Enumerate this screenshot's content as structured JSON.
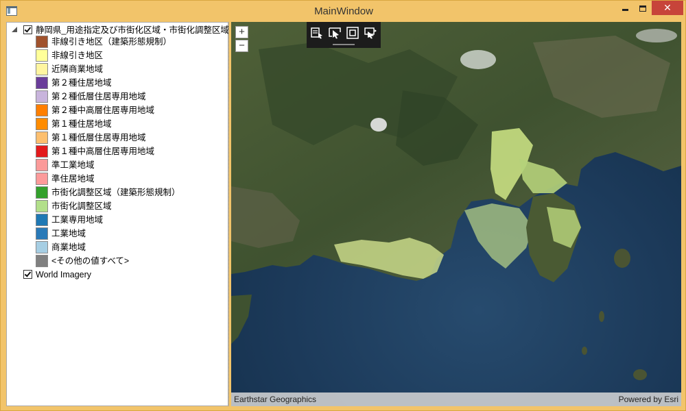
{
  "window": {
    "title": "MainWindow",
    "close_glyph": "✕"
  },
  "map_controls": {
    "zoom_in": "+",
    "zoom_out": "−"
  },
  "toolbar": {
    "tools": [
      "select-add-icon",
      "select-pointer-icon",
      "select-rectangle-icon",
      "select-move-icon"
    ]
  },
  "layers": [
    {
      "label": "静岡県_用途指定及び市街化区域・市街化調整区域",
      "checked": true,
      "expanded": true,
      "legend": [
        {
          "label": "非線引き地区（建築形態規制）",
          "color": "#a0522d"
        },
        {
          "label": "非線引き地区",
          "color": "#ffff99"
        },
        {
          "label": "近隣商業地域",
          "color": "#fff5a0"
        },
        {
          "label": "第２種住居地域",
          "color": "#6a3d9a"
        },
        {
          "label": "第２種低層住居専用地域",
          "color": "#c8b4dc"
        },
        {
          "label": "第２種中高層住居専用地域",
          "color": "#ff7f00"
        },
        {
          "label": "第１種住居地域",
          "color": "#ff8c00"
        },
        {
          "label": "第１種低層住居専用地域",
          "color": "#fdbf6f"
        },
        {
          "label": "第１種中高層住居専用地域",
          "color": "#e31a1c"
        },
        {
          "label": "準工業地域",
          "color": "#fb9a99"
        },
        {
          "label": "準住居地域",
          "color": "#fc9a9a"
        },
        {
          "label": "市街化調整区域（建築形態規制）",
          "color": "#33a02c"
        },
        {
          "label": "市街化調整区域",
          "color": "#b2df8a"
        },
        {
          "label": "工業専用地域",
          "color": "#1f78b4"
        },
        {
          "label": "工業地域",
          "color": "#2a7ab8"
        },
        {
          "label": "商業地域",
          "color": "#a6cee3"
        },
        {
          "label": "<その他の値すべて>",
          "color": "#808080"
        }
      ]
    },
    {
      "label": "World Imagery",
      "checked": true
    }
  ],
  "attribution": {
    "left": "Earthstar Geographics",
    "right": "Powered by Esri"
  }
}
